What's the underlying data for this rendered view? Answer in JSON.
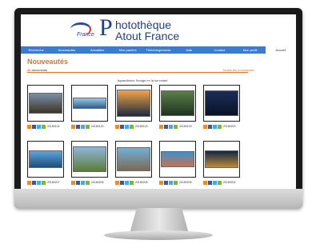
{
  "site": {
    "logo_small": "France",
    "logo_letter": "P",
    "logo_line1": "hotothèque",
    "logo_line2": "Atout France"
  },
  "nav": [
    "Recherche",
    "Nouveautés",
    "Actualités",
    "Mes paniers",
    "Téléchargements",
    "Aide",
    "Contact",
    "Mon profil",
    "Accueil"
  ],
  "page": {
    "title": "Nouveautés",
    "count_number": "36",
    "count_label": " documents",
    "all_link": "Toutes les nouveautés",
    "hint": "Agrandissez l'image en la survolant"
  },
  "thumbnails": [
    {
      "ref": "20180104",
      "c1": "#7a8fa8",
      "c2": "#3d3526"
    },
    {
      "ref": "20180120",
      "c1": "#9cc6e8",
      "c2": "#2f5f8a"
    },
    {
      "ref": "20180125",
      "c1": "#f2a44a",
      "c2": "#1d2a3e"
    },
    {
      "ref": "20180103",
      "c1": "#5b7f4a",
      "c2": "#1f3320"
    },
    {
      "ref": "20180200",
      "c1": "#1b2d5a",
      "c2": "#0a1226"
    },
    {
      "ref": "20180207",
      "c1": "#5aa6e0",
      "c2": "#1e4e7a"
    },
    {
      "ref": "20180206",
      "c1": "#8fb7d8",
      "c2": "#5e7a3a"
    },
    {
      "ref": "20180208",
      "c1": "#6fb0d8",
      "c2": "#7c6a52"
    },
    {
      "ref": "20180205",
      "c1": "#3f8fd0",
      "c2": "#c9734a"
    },
    {
      "ref": "20180202",
      "c1": "#142544",
      "c2": "#b98a3a"
    }
  ]
}
